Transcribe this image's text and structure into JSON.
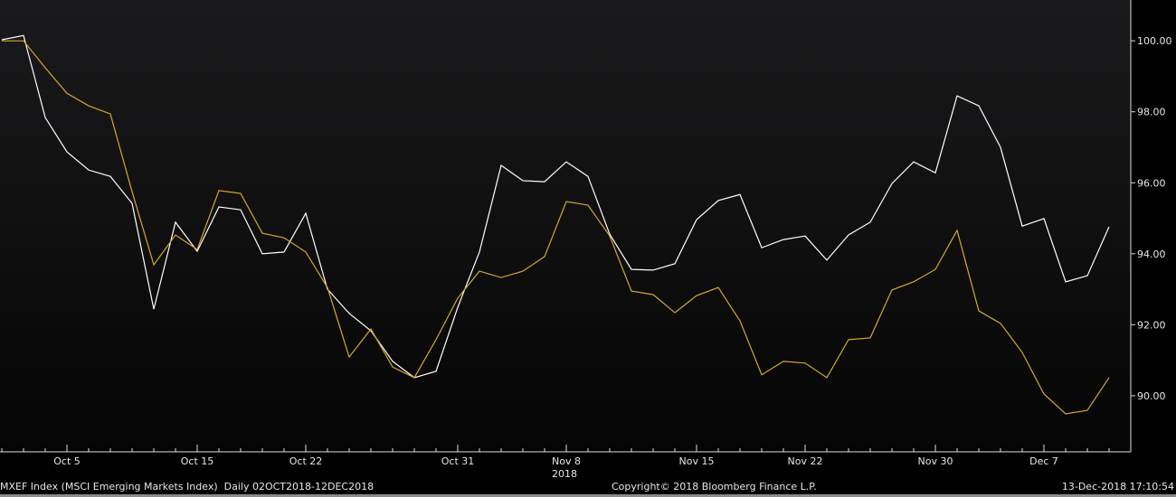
{
  "chart_data": {
    "type": "line",
    "title": "",
    "xlabel": "2018",
    "ylabel": "",
    "ylim": [
      88.42,
      101.15
    ],
    "y_ticks": [
      "90.00",
      "92.00",
      "94.00",
      "96.00",
      "98.00",
      "100.00"
    ],
    "y_tick_values": [
      90,
      92,
      94,
      96,
      98,
      100
    ],
    "x_ticks": [
      {
        "label": "Oct 5",
        "index": 3
      },
      {
        "label": "Oct 15",
        "index": 9
      },
      {
        "label": "Oct 22",
        "index": 14
      },
      {
        "label": "Oct 31",
        "index": 21
      },
      {
        "label": "Nov 8",
        "index": 26
      },
      {
        "label": "Nov 15",
        "index": 32
      },
      {
        "label": "Nov 22",
        "index": 37
      },
      {
        "label": "Nov 30",
        "index": 43
      },
      {
        "label": "Dec 7",
        "index": 48
      }
    ],
    "year_label": "2018",
    "grid": false,
    "series": [
      {
        "name": "white",
        "color": "#ffffff",
        "values": [
          100.03,
          100.15,
          97.84,
          96.87,
          96.36,
          96.18,
          95.42,
          92.44,
          94.89,
          94.07,
          95.32,
          95.24,
          94.0,
          94.05,
          95.14,
          93.0,
          92.32,
          91.83,
          90.97,
          90.51,
          90.69,
          92.49,
          94.05,
          96.49,
          96.06,
          96.03,
          96.59,
          96.18,
          94.55,
          93.56,
          93.54,
          93.72,
          94.96,
          95.5,
          95.67,
          94.17,
          94.4,
          94.5,
          93.82,
          94.53,
          94.89,
          95.98,
          96.59,
          96.28,
          98.45,
          98.17,
          97.0,
          94.78,
          94.99,
          93.21,
          93.38,
          94.76
        ]
      },
      {
        "name": "gold",
        "color": "#d4a72c",
        "values": [
          100.0,
          100.0,
          99.24,
          98.52,
          98.17,
          97.94,
          95.75,
          93.69,
          94.53,
          94.12,
          95.78,
          95.7,
          94.58,
          94.45,
          94.05,
          93.05,
          91.09,
          91.88,
          90.81,
          90.51,
          91.58,
          92.75,
          93.51,
          93.33,
          93.51,
          93.92,
          95.47,
          95.37,
          94.5,
          92.95,
          92.85,
          92.34,
          92.82,
          93.05,
          92.11,
          90.59,
          90.97,
          90.92,
          90.51,
          91.58,
          91.63,
          92.98,
          93.21,
          93.56,
          94.66,
          92.39,
          92.04,
          91.22,
          90.05,
          89.49,
          89.59,
          90.51
        ]
      }
    ]
  },
  "footer": {
    "index_info": "MXEF Index (MSCI Emerging Markets Index)  Daily 02OCT2018-12DEC2018",
    "copyright": "Copyright© 2018 Bloomberg Finance L.P.",
    "timestamp": "13-Dec-2018 17:10:54"
  }
}
